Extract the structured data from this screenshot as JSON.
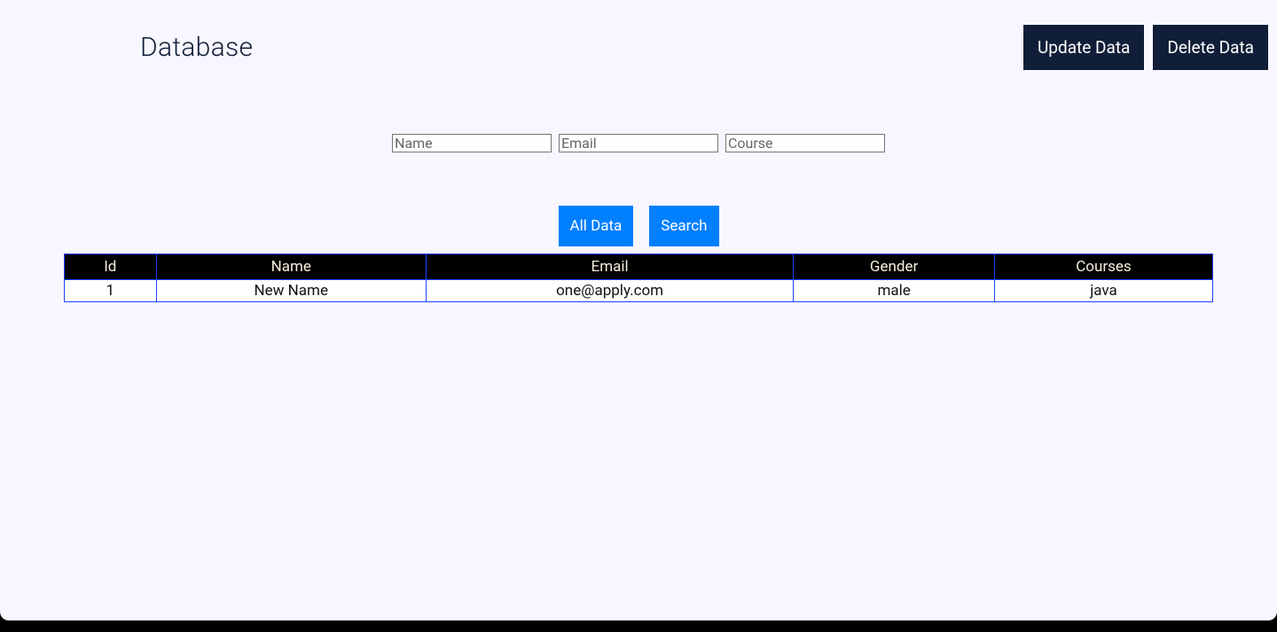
{
  "header": {
    "title": "Database",
    "update_label": "Update Data",
    "delete_label": "Delete Data"
  },
  "search": {
    "name_placeholder": "Name",
    "email_placeholder": "Email",
    "course_placeholder": "Course",
    "name_value": "",
    "email_value": "",
    "course_value": ""
  },
  "actions": {
    "all_data_label": "All Data",
    "search_label": "Search"
  },
  "table": {
    "headers": {
      "id": "Id",
      "name": "Name",
      "email": "Email",
      "gender": "Gender",
      "courses": "Courses"
    },
    "rows": [
      {
        "id": "1",
        "name": "New Name",
        "email": "one@apply.com",
        "gender": "male",
        "courses": "java"
      }
    ]
  }
}
